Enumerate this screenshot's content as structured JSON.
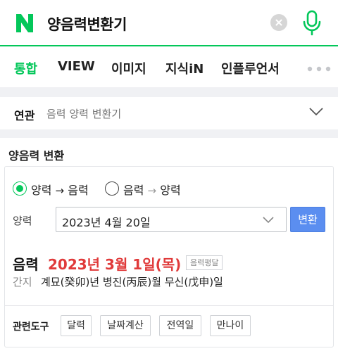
{
  "search": {
    "query": "양음력변환기",
    "logo_letter": "N"
  },
  "tabs": [
    {
      "label": "통합",
      "active": true
    },
    {
      "label": "VIEW",
      "active": false
    },
    {
      "label": "이미지",
      "active": false
    },
    {
      "label": "지식iN",
      "active": false
    },
    {
      "label": "인플루언서",
      "active": false
    }
  ],
  "related": {
    "label": "연관",
    "terms": "음력 양력 변환기"
  },
  "converter": {
    "title": "양음력 변환",
    "options": [
      {
        "from": "양력",
        "to": "음력",
        "checked": true
      },
      {
        "from": "음력",
        "to": "양력",
        "checked": false
      }
    ],
    "arrow": "→",
    "input_label": "양력",
    "input_value": "2023년 4월 20일",
    "convert_button": "변환",
    "result_label": "음력",
    "result_date": "2023년 3월 1일(목)",
    "result_badge": "음력평달",
    "ganji_label": "간지",
    "ganji_value": "계묘(癸卯)년 병진(丙辰)월 무신(戊申)일",
    "tools_label": "관련도구",
    "tools": [
      "달력",
      "날짜계산",
      "전역일",
      "만나이"
    ]
  },
  "colors": {
    "brand_green": "#03c75a",
    "result_red": "#e03a3a",
    "button_blue": "#5b8ef0"
  },
  "icons": [
    "naver-logo-icon",
    "clear-icon",
    "microphone-icon",
    "more-dots-icon",
    "chevron-down-icon"
  ]
}
